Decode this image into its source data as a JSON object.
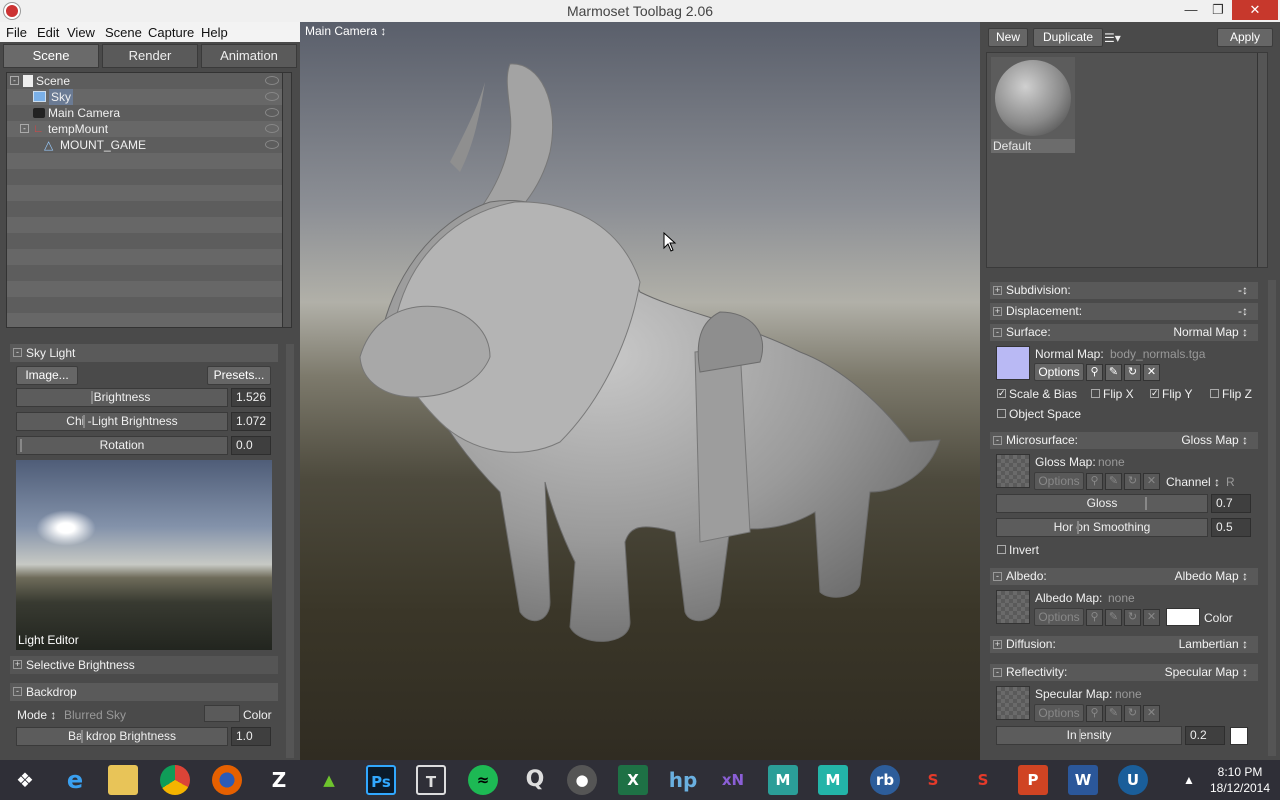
{
  "window": {
    "title": "Marmoset Toolbag 2.06",
    "minimize": "—",
    "maximize": "❐",
    "close": "✕"
  },
  "menu": [
    "File",
    "Edit",
    "View",
    "Scene",
    "Capture",
    "Help"
  ],
  "tabs": [
    "Scene",
    "Render",
    "Animation"
  ],
  "tree": [
    "Scene",
    "Sky",
    "Main Camera",
    "tempMount",
    "MOUNT_GAME"
  ],
  "skylight": {
    "header": "Sky Light",
    "image_btn": "Image...",
    "presets_btn": "Presets...",
    "brightness_label": "Brightness",
    "brightness": "1.526",
    "child_label": "Chi  -Light Brightness",
    "child": "1.072",
    "rotation_label": "Rotation",
    "rotation": "0.0",
    "editor_label": "Light Editor",
    "selective": "Selective Brightness"
  },
  "backdrop": {
    "header": "Backdrop",
    "mode_label": "Mode ↕",
    "mode_value": "Blurred Sky",
    "color_label": "Color",
    "brightness_label": "Ba   kdrop Brightness",
    "brightness": "1.0"
  },
  "viewport": {
    "camera": "Main Camera ↕"
  },
  "material": {
    "new": "New",
    "duplicate": "Duplicate",
    "apply": "Apply",
    "name": "Default",
    "menu_icon": "☰▾"
  },
  "subdivision": "Subdivision:",
  "displacement": "Displacement:",
  "surface": {
    "header": "Surface:",
    "mode": "Normal Map ↕",
    "map_label": "Normal Map:",
    "map_file": "body_normals.tga",
    "options": "Options",
    "scale_bias": "Scale & Bias",
    "flip_x": "Flip X",
    "flip_y": "Flip Y",
    "flip_z": "Flip Z",
    "object_space": "Object Space"
  },
  "microsurface": {
    "header": "Microsurface:",
    "mode": "Gloss Map ↕",
    "map_label": "Gloss Map:",
    "map_file": "none",
    "options": "Options",
    "channel_label": "Channel ↕",
    "channel_value": "R",
    "gloss_label": "Gloss",
    "gloss": "0.7",
    "horizon_label": "Hor   on Smoothing",
    "horizon": "0.5",
    "invert": "Invert"
  },
  "albedo": {
    "header": "Albedo:",
    "mode": "Albedo Map ↕",
    "map_label": "Albedo Map:",
    "map_file": "none",
    "options": "Options",
    "color_label": "Color"
  },
  "diffusion": {
    "header": "Diffusion:",
    "mode": "Lambertian ↕"
  },
  "reflectivity": {
    "header": "Reflectivity:",
    "mode": "Specular Map ↕",
    "map_label": "Specular Map:",
    "map_file": "none",
    "options": "Options",
    "intensity_label": "In   ensity",
    "intensity": "0.2"
  },
  "taskbar": {
    "time": "8:10 PM",
    "date": "18/12/2014",
    "icons": [
      "windows-start",
      "internet-explorer",
      "file-explorer",
      "chrome",
      "firefox",
      "zbrush",
      "substance-green",
      "photoshop",
      "topogun",
      "spotify",
      "quixel",
      "marmoset",
      "excel",
      "hp",
      "xnormal",
      "mudbox",
      "maya",
      "rb",
      "substance-painter",
      "substance-designer",
      "powerpoint",
      "word",
      "unreal"
    ]
  }
}
